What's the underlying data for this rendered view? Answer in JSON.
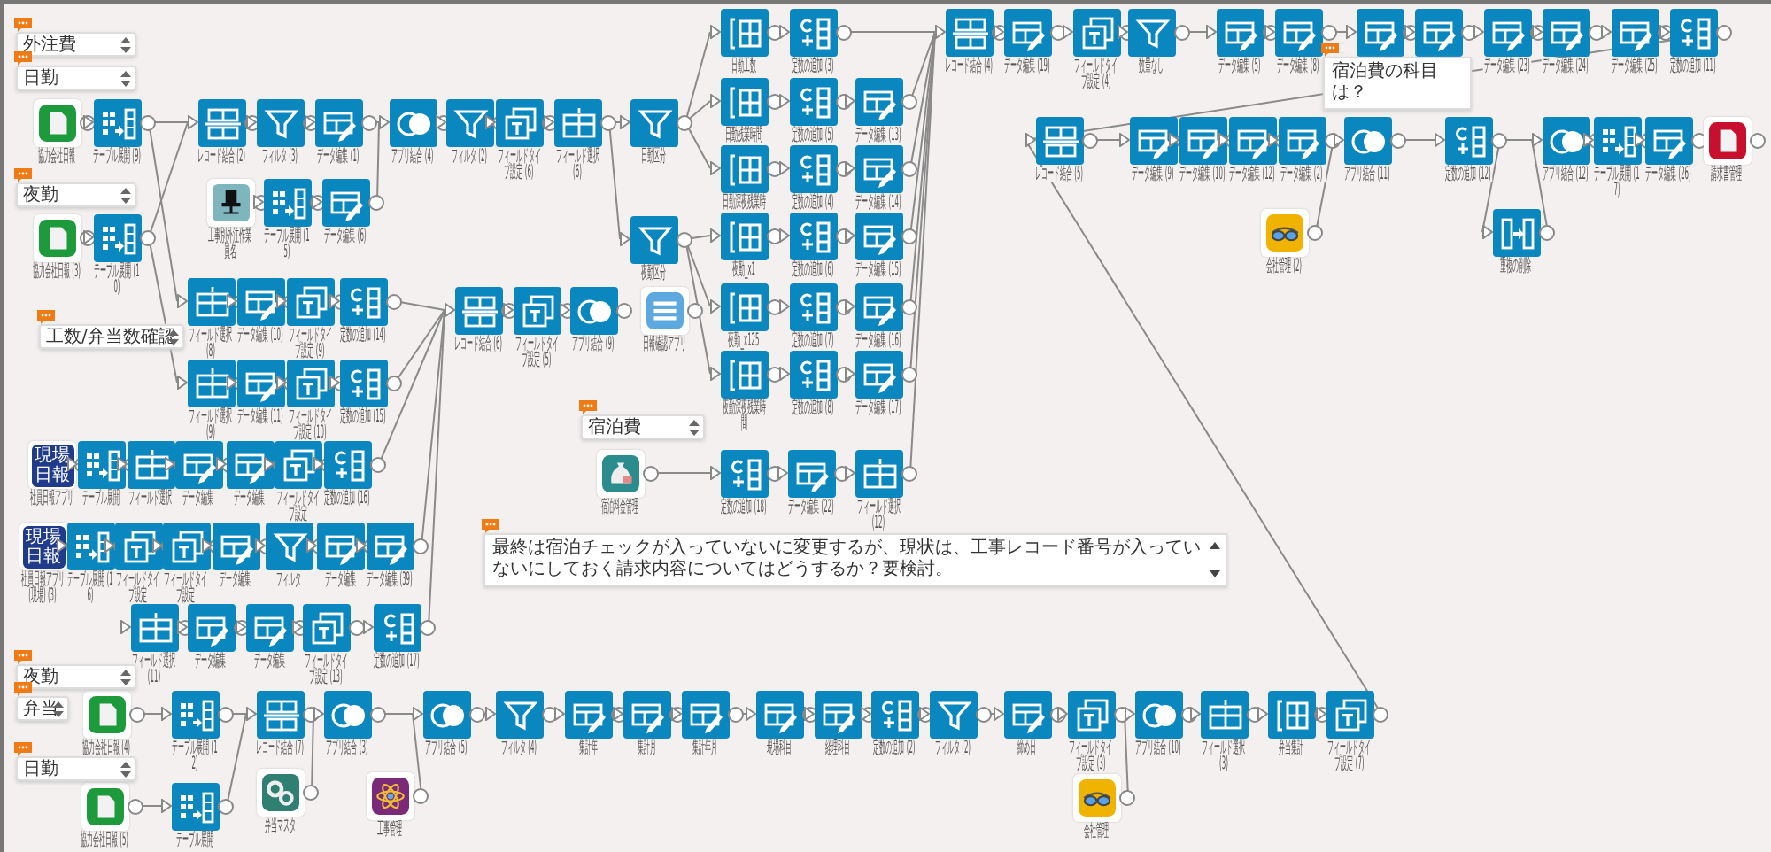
{
  "nodes": [
    {
      "kind": "document-app",
      "label": "協力会社日報"
    },
    {
      "kind": "expand",
      "label": "テーブル展開 (9)"
    },
    {
      "kind": "merge",
      "label": "レコード結合 (2)"
    },
    {
      "kind": "filter",
      "label": "フィルタ (3)"
    },
    {
      "kind": "edit",
      "label": "データ編集 (1)"
    },
    {
      "kind": "join",
      "label": "アプリ結合 (4)"
    },
    {
      "kind": "filter",
      "label": "フィルタ (2)"
    },
    {
      "kind": "ftype",
      "label": "フィールドタイプ設定 (6)"
    },
    {
      "kind": "select",
      "label": "フィールド選択 (6)"
    },
    {
      "kind": "filter",
      "label": "日勤区分"
    },
    {
      "kind": "column",
      "label": "日勤工数"
    },
    {
      "kind": "const",
      "label": "定数の追加 (3)"
    },
    {
      "kind": "column",
      "label": "日勤残業時間"
    },
    {
      "kind": "const",
      "label": "定数の追加 (5)"
    },
    {
      "kind": "edit",
      "label": "データ編集 (13)"
    },
    {
      "kind": "column",
      "label": "日勤深夜残業時"
    },
    {
      "kind": "const",
      "label": "定数の追加 (4)"
    },
    {
      "kind": "edit",
      "label": "データ編集 (14)"
    },
    {
      "kind": "filter",
      "label": "夜勤区分"
    },
    {
      "kind": "column",
      "label": "夜勤_x1"
    },
    {
      "kind": "const",
      "label": "定数の追加 (6)"
    },
    {
      "kind": "edit",
      "label": "データ編集 (15)"
    },
    {
      "kind": "column",
      "label": "夜勤_x125"
    },
    {
      "kind": "const",
      "label": "定数の追加 (7)"
    },
    {
      "kind": "edit",
      "label": "データ編集 (16)"
    },
    {
      "kind": "column",
      "label": "夜勤深夜残業時間"
    },
    {
      "kind": "const",
      "label": "定数の追加 (8)"
    },
    {
      "kind": "edit",
      "label": "データ編集 (17)"
    },
    {
      "kind": "merge",
      "label": "レコード結合 (4)"
    },
    {
      "kind": "edit",
      "label": "データ編集 (19)"
    },
    {
      "kind": "ftype",
      "label": "フィールドタイプ設定 (4)"
    },
    {
      "kind": "filter",
      "label": "数量なし"
    },
    {
      "kind": "edit",
      "label": "データ編集 (5)"
    },
    {
      "kind": "edit",
      "label": "データ編集 (8)"
    },
    {
      "kind": "edit"
    },
    {
      "kind": "edit"
    },
    {
      "kind": "edit",
      "label": "データ編集 (23)"
    },
    {
      "kind": "edit",
      "label": "データ編集 (24)"
    },
    {
      "kind": "edit",
      "label": "データ編集 (25)"
    },
    {
      "kind": "const",
      "label": "定数の追加 (11)"
    },
    {
      "kind": "merge",
      "label": "レコード結合 (5)"
    },
    {
      "kind": "edit",
      "label": "データ編集 (9)"
    },
    {
      "kind": "edit",
      "label": "データ編集 (10)"
    },
    {
      "kind": "edit",
      "label": "データ編集 (12)"
    },
    {
      "kind": "edit",
      "label": "データ編集 (2)"
    },
    {
      "kind": "join",
      "label": "アプリ結合 (11)"
    },
    {
      "kind": "const",
      "label": "定数の追加 (12)"
    },
    {
      "kind": "join",
      "label": "アプリ結合 (12)"
    },
    {
      "kind": "expand",
      "label": "テーブル展開 (17)"
    },
    {
      "kind": "edit",
      "label": "データ編集 (26)"
    },
    {
      "kind": "invoice-app",
      "label": "請求書管理"
    },
    {
      "kind": "glasses-app",
      "label": "会社管理 (2)"
    },
    {
      "kind": "dedupe",
      "label": "重複の削除"
    },
    {
      "kind": "chair-app",
      "label": "工事別外注作業員名"
    },
    {
      "kind": "expand",
      "label": "テーブル展開 (15)"
    },
    {
      "kind": "edit",
      "label": "データ編集 (6)"
    },
    {
      "kind": "document-app",
      "label": "協力会社日報 (3)"
    },
    {
      "kind": "expand",
      "label": "テーブル展開 (10)"
    },
    {
      "kind": "select",
      "label": "フィールド選択 (8)"
    },
    {
      "kind": "edit",
      "label": "データ編集 (10)"
    },
    {
      "kind": "ftype",
      "label": "フィールドタイプ設定 (9)"
    },
    {
      "kind": "const",
      "label": "定数の追加 (14)"
    },
    {
      "kind": "select",
      "label": "フィールド選択 (9)"
    },
    {
      "kind": "edit",
      "label": "データ編集 (11)"
    },
    {
      "kind": "ftype",
      "label": "フィールドタイプ設定 (10)"
    },
    {
      "kind": "const",
      "label": "定数の追加 (15)"
    },
    {
      "kind": "merge",
      "label": "レコード結合 (6)"
    },
    {
      "kind": "ftype",
      "label": "フィールドタイプ設定 (5)"
    },
    {
      "kind": "join",
      "label": "アプリ結合 (9)"
    },
    {
      "kind": "list-app",
      "label": "日報確認アプリ"
    },
    {
      "kind": "badge-app",
      "badge": "現場日報",
      "label": "社員日報アプリ"
    },
    {
      "kind": "expand",
      "label": "テーブル展開"
    },
    {
      "kind": "select",
      "label": "フィールド選択"
    },
    {
      "kind": "edit",
      "label": "データ編集"
    },
    {
      "kind": "edit",
      "label": "データ編集"
    },
    {
      "kind": "ftype",
      "label": "フィールドタイプ設定"
    },
    {
      "kind": "const",
      "label": "定数の追加 (16)"
    },
    {
      "kind": "badge-app",
      "badge": "現場日報",
      "label": "社員日報アプリ (現場) (3)"
    },
    {
      "kind": "expand",
      "label": "テーブル展開 (16)"
    },
    {
      "kind": "ftype",
      "label": "フィールドタイプ設定"
    },
    {
      "kind": "ftype",
      "label": "フィールドタイプ設定"
    },
    {
      "kind": "edit",
      "label": "データ編集"
    },
    {
      "kind": "filter",
      "label": "フィルタ"
    },
    {
      "kind": "edit",
      "label": "データ編集"
    },
    {
      "kind": "edit",
      "label": "データ編集 (39)"
    },
    {
      "kind": "select",
      "label": "フィールド選択 (11)"
    },
    {
      "kind": "edit",
      "label": "データ編集"
    },
    {
      "kind": "edit",
      "label": "データ編集"
    },
    {
      "kind": "ftype",
      "label": "フィールドタイプ設定 (13)"
    },
    {
      "kind": "const",
      "label": "定数の追加 (17)"
    },
    {
      "kind": "moneybag-app",
      "label": "宿泊料金管理"
    },
    {
      "kind": "const",
      "label": "定数の追加 (18)"
    },
    {
      "kind": "edit",
      "label": "データ編集 (22)"
    },
    {
      "kind": "select",
      "label": "フィールド選択 (12)"
    },
    {
      "kind": "document-app",
      "label": "協力会社日報 (4)"
    },
    {
      "kind": "expand",
      "label": "テーブル展開 (12)"
    },
    {
      "kind": "merge",
      "label": "レコード結合 (7)"
    },
    {
      "kind": "join",
      "label": "アプリ結合 (3)"
    },
    {
      "kind": "document-app",
      "label": "協力会社日報 (5)"
    },
    {
      "kind": "expand",
      "label": "テーブル展開"
    },
    {
      "kind": "gears-app",
      "label": "弁当マスタ"
    },
    {
      "kind": "join",
      "label": "アプリ結合 (5)"
    },
    {
      "kind": "atom-app",
      "label": "工事管理"
    },
    {
      "kind": "filter",
      "label": "フィルタ (4)"
    },
    {
      "kind": "edit",
      "label": "集計年"
    },
    {
      "kind": "edit",
      "label": "集計月"
    },
    {
      "kind": "edit",
      "label": "集計年月"
    },
    {
      "kind": "edit",
      "label": "現場科目"
    },
    {
      "kind": "edit",
      "label": "経理科目"
    },
    {
      "kind": "const",
      "label": "定数の追加 (2)"
    },
    {
      "kind": "filter",
      "label": "フィルタ (2)"
    },
    {
      "kind": "edit",
      "label": "締め日"
    },
    {
      "kind": "ftype",
      "label": "フィールドタイプ設定 (3)"
    },
    {
      "kind": "join",
      "label": "アプリ結合 (10)"
    },
    {
      "kind": "select",
      "label": "フィールド選択 (3)"
    },
    {
      "kind": "column",
      "label": "弁当集計"
    },
    {
      "kind": "ftype",
      "label": "フィールドタイプ設定 (7)"
    },
    {
      "kind": "glasses-app",
      "label": "会社管理"
    }
  ],
  "comments": [
    {
      "kind": "dropdown",
      "value": "外注費"
    },
    {
      "kind": "dropdown",
      "value": "日勤"
    },
    {
      "kind": "dropdown",
      "value": "夜勤"
    },
    {
      "kind": "dropdown",
      "value": "工数/弁当数確認"
    },
    {
      "kind": "dropdown",
      "value": "宿泊費"
    },
    {
      "kind": "dropdown",
      "value": "夜勤"
    },
    {
      "kind": "dropdown",
      "value": "弁当"
    },
    {
      "kind": "dropdown",
      "value": "日勤"
    },
    {
      "kind": "note",
      "value": "宿泊費の科目は？"
    },
    {
      "kind": "note",
      "value": "最終は宿泊チェックが入っていないに変更するが、現状は、工事レコード番号が入っていないにしておく請求内容についてはどうするか？要検討。",
      "scroll": true
    }
  ]
}
